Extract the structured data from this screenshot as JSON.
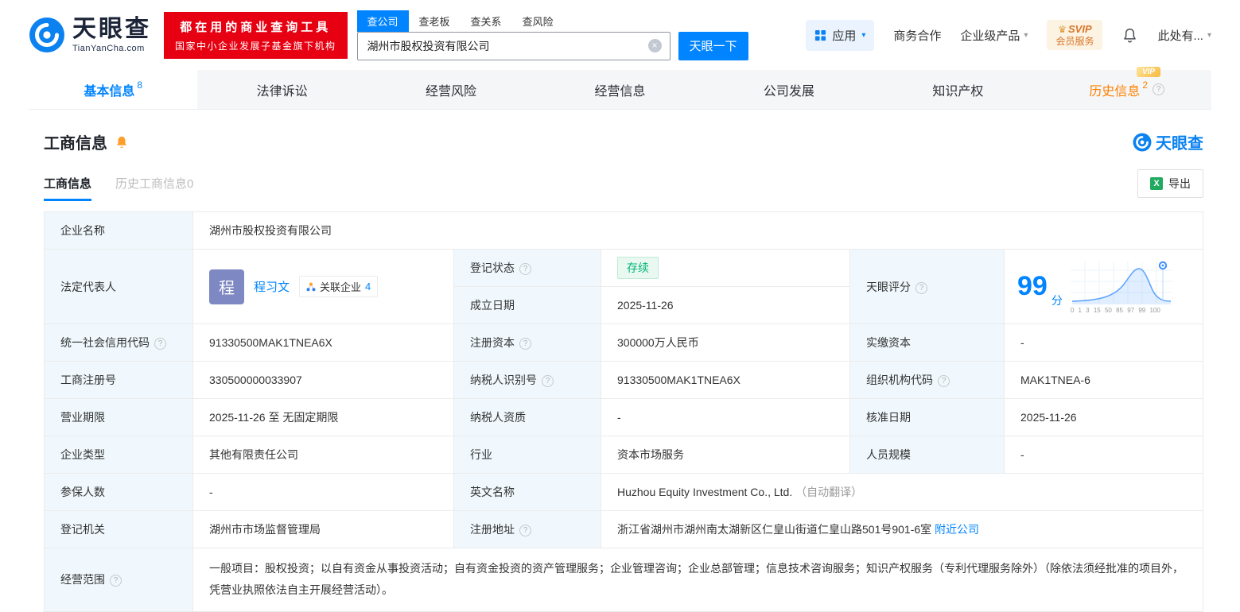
{
  "icons": {
    "caret_down": "▾",
    "help": "?",
    "clear": "×",
    "crown": "♛",
    "excel": "X"
  },
  "header": {
    "logo_name": "天眼查",
    "logo_domain": "TianYanCha.com",
    "promo_line1": "都在用的商业查询工具",
    "promo_line2": "国家中小企业发展子基金旗下机构",
    "search_tabs": [
      {
        "label": "查公司"
      },
      {
        "label": "查老板"
      },
      {
        "label": "查关系"
      },
      {
        "label": "查风险"
      }
    ],
    "search_query": "湖州市股权投资有限公司",
    "search_button": "天眼一下",
    "apps_label": "应用",
    "biz_label": "商务合作",
    "enterprise_label": "企业级产品",
    "svip_line1": "SVIP",
    "svip_line2": "会员服务",
    "account_label": "此处有..."
  },
  "nav_tabs": [
    {
      "label": "基本信息",
      "badge": "8"
    },
    {
      "label": "法律诉讼"
    },
    {
      "label": "经营风险"
    },
    {
      "label": "经营信息"
    },
    {
      "label": "公司发展"
    },
    {
      "label": "知识产权"
    },
    {
      "label": "历史信息",
      "badge": "2",
      "tag": "VIP"
    }
  ],
  "section": {
    "title": "工商信息",
    "brand": "天眼查",
    "subtab_active": "工商信息",
    "subtab_inactive": "历史工商信息0",
    "export_label": "导出"
  },
  "fields": {
    "company_name": {
      "label": "企业名称",
      "value": "湖州市股权投资有限公司"
    },
    "legal_rep": {
      "label": "法定代表人",
      "avatar": "程",
      "name": "程习文",
      "related_label": "关联企业",
      "related_count": "4"
    },
    "reg_status": {
      "label": "登记状态",
      "value": "存续"
    },
    "establish_date": {
      "label": "成立日期",
      "value": "2025-11-26"
    },
    "score": {
      "label": "天眼评分",
      "value": "99",
      "unit": "分",
      "axis": "0 1 3 15 50 85 97 99 100"
    },
    "credit_code": {
      "label": "统一社会信用代码",
      "value": "91330500MAK1TNEA6X"
    },
    "reg_capital": {
      "label": "注册资本",
      "value": "300000万人民币"
    },
    "paid_capital": {
      "label": "实缴资本",
      "value": "-"
    },
    "reg_number": {
      "label": "工商注册号",
      "value": "330500000033907"
    },
    "taxpayer_id": {
      "label": "纳税人识别号",
      "value": "91330500MAK1TNEA6X"
    },
    "org_code": {
      "label": "组织机构代码",
      "value": "MAK1TNEA-6"
    },
    "business_term": {
      "label": "营业期限",
      "value": "2025-11-26 至 无固定期限"
    },
    "taxpayer_qual": {
      "label": "纳税人资质",
      "value": "-"
    },
    "approval_date": {
      "label": "核准日期",
      "value": "2025-11-26"
    },
    "company_type": {
      "label": "企业类型",
      "value": "其他有限责任公司"
    },
    "industry": {
      "label": "行业",
      "value": "资本市场服务"
    },
    "staff_size": {
      "label": "人员规模",
      "value": "-"
    },
    "insured_count": {
      "label": "参保人数",
      "value": "-"
    },
    "english_name": {
      "label": "英文名称",
      "value": "Huzhou Equity Investment Co., Ltd.",
      "note": "（自动翻译）"
    },
    "reg_authority": {
      "label": "登记机关",
      "value": "湖州市市场监督管理局"
    },
    "reg_address": {
      "label": "注册地址",
      "value": "浙江省湖州市湖州南太湖新区仁皇山街道仁皇山路501号901-6室",
      "link": "附近公司"
    },
    "business_scope": {
      "label": "经营范围",
      "value": "一般项目：股权投资；以自有资金从事投资活动；自有资金投资的资产管理服务；企业管理咨询；企业总部管理；信息技术咨询服务；知识产权服务（专利代理服务除外）（除依法须经批准的项目外，凭营业执照依法自主开展经营活动）。"
    }
  }
}
